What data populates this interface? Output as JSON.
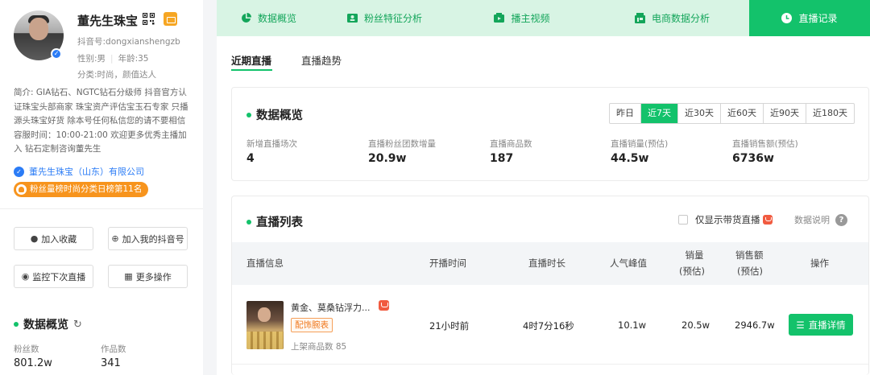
{
  "profile": {
    "name": "董先生珠宝",
    "douyin_id": "抖音号:dongxianshengzb",
    "gender": "性别:男",
    "age": "年龄:35",
    "category": "分类:时尚，颜值达人",
    "bio": "简介: GIA钻石、NGTC钻石分级师 抖音官方认证珠宝头部商家 珠宝资产评估宝玉石专家 只播源头珠宝好货 除本号任何私信您的请不要相信 容服时间：10:00-21:00 欢迎更多优秀主播加入 钻石定制咨询董先生",
    "company": "董先生珠宝（山东）有限公司",
    "rank": "粉丝量榜时尚分类日榜第11名"
  },
  "actions": {
    "favorite": "加入收藏",
    "add_mine": "加入我的抖音号",
    "monitor": "监控下次直播",
    "more": "更多操作"
  },
  "sidebar_overview": {
    "title": "数据概览",
    "fans_label": "粉丝数",
    "fans_value": "801.2w",
    "works_label": "作品数",
    "works_value": "341"
  },
  "nav": {
    "tabs": [
      {
        "label": "数据概览"
      },
      {
        "label": "粉丝特征分析"
      },
      {
        "label": "播主视频"
      },
      {
        "label": "电商数据分析"
      },
      {
        "label": "直播记录"
      }
    ],
    "active_index": 4
  },
  "subtabs": [
    "近期直播",
    "直播趋势"
  ],
  "overview": {
    "title": "数据概览",
    "ranges": [
      "昨日",
      "近7天",
      "近30天",
      "近60天",
      "近90天",
      "近180天"
    ],
    "active_range": "近7天",
    "kpis": [
      {
        "label": "新增直播场次",
        "value": "4"
      },
      {
        "label": "直播粉丝团数增量",
        "value": "20.9w"
      },
      {
        "label": "直播商品数",
        "value": "187"
      },
      {
        "label": "直播销量(预估)",
        "value": "44.5w"
      },
      {
        "label": "直播销售额(预估)",
        "value": "6736w"
      }
    ]
  },
  "live_list": {
    "title": "直播列表",
    "only_goods_label": "仅显示带货直播",
    "data_help": "数据说明",
    "columns": {
      "info": "直播信息",
      "start": "开播时间",
      "duration": "直播时长",
      "peak": "人气峰值",
      "sales_1": "销量",
      "sales_2": "(预估)",
      "revenue_1": "销售额",
      "revenue_2": "(预估)",
      "action": "操作"
    },
    "rows": [
      {
        "title": "黄金、莫桑钻浮力...",
        "tag": "配饰腕表",
        "goods": "上架商品数 85",
        "start": "21小时前",
        "duration": "4时7分16秒",
        "peak": "10.1w",
        "sales": "20.5w",
        "revenue": "2946.7w",
        "button": "直播详情"
      }
    ]
  },
  "colors": {
    "accent": "#13c26b",
    "nav_bg": "#d8f4e4",
    "link": "#2b7cf6",
    "badge": "#f7941d"
  }
}
